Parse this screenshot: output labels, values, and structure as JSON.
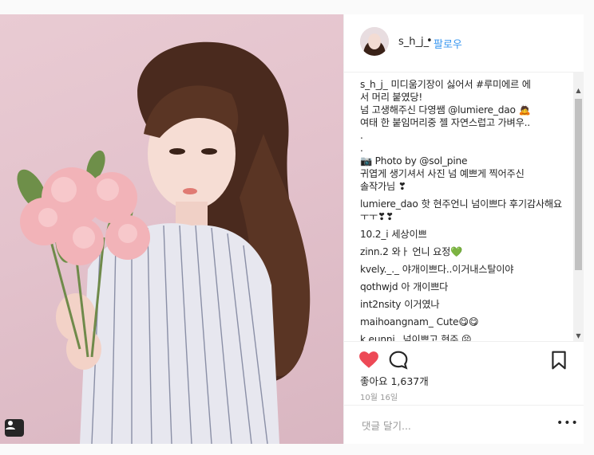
{
  "post": {
    "username": "s_h_j_",
    "separator": "•",
    "follow_label": "팔로우",
    "caption": {
      "user": "s_h_j_",
      "lines": [
        "미디움기장이 싫어서 #루미에르 에",
        "서 머리 붙였당!",
        "넘 고생해주신 다영쌤 @lumiere_dao 🙇",
        "여태 한 붙임머리중 젤 자연스럽고 가벼우..",
        ".",
        ".",
        "📷 Photo by @sol_pine",
        "귀엽게 생기셔서 사진 넘 예쁘게 찍어주신",
        "솔작가님 ❣"
      ]
    },
    "comments": [
      {
        "user": "lumiere_dao",
        "text": "핫 현주언니 넘이쁘다 후기감사해요 ㅜㅜ❣❣"
      },
      {
        "user": "10.2_i",
        "text": "세상이쁘"
      },
      {
        "user": "zinn.2",
        "text": "와ㅏ 언니 요정💚"
      },
      {
        "user": "kvely._._",
        "text": "야개이쁘다..이거내스탈이야"
      },
      {
        "user": "qothwjd",
        "text": "아 개이쁘다"
      },
      {
        "user": "int2nsity",
        "text": "이거였나"
      },
      {
        "user": "maihoangnam_",
        "text": "Cute😋😋"
      },
      {
        "user": "k.eunni_",
        "text": "넘이쁘고 현주 😣"
      }
    ],
    "likes_text": "좋아요 1,637개",
    "date": "10월 16일",
    "comment_placeholder": "댓글 달기...",
    "more_label": "•••"
  },
  "icons": {
    "like": "heart-icon",
    "comment": "comment-bubble-icon",
    "save": "bookmark-icon",
    "tag": "person-tag-icon",
    "scroll_up": "scroll-up-arrow-icon",
    "scroll_down": "scroll-down-arrow-icon"
  },
  "colors": {
    "like": "#ed4956",
    "link": "#3897f0",
    "text": "#262626",
    "muted": "#999999"
  }
}
